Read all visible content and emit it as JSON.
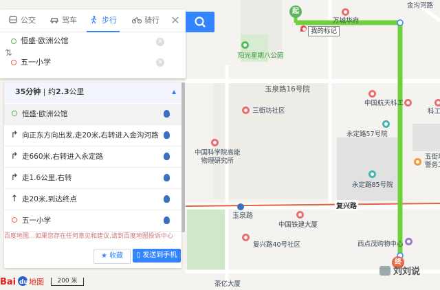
{
  "tabs": [
    {
      "label": "公交",
      "icon": "bus-icon"
    },
    {
      "label": "驾车",
      "icon": "car-icon"
    },
    {
      "label": "步行",
      "icon": "walk-icon"
    },
    {
      "label": "骑行",
      "icon": "bike-icon"
    }
  ],
  "route": {
    "start": "恒盛·欧洲公馆",
    "end": "五一小学"
  },
  "summary": {
    "time": "35分钟",
    "distance_prefix": "约",
    "distance": "2.3",
    "distance_unit": "公里"
  },
  "steps": [
    {
      "arrow": "dot-start",
      "text": "恒盛·欧洲公馆"
    },
    {
      "arrow": "turn-right",
      "text": "向正东方向出发,走20米,右转进入金沟河路"
    },
    {
      "arrow": "turn-right",
      "text": "走660米,右转进入永定路"
    },
    {
      "arrow": "turn-right",
      "text": "走1.6公里,右转"
    },
    {
      "arrow": "straight",
      "text": "走20米,到达终点"
    },
    {
      "arrow": "dot-end",
      "text": "五一小学"
    }
  ],
  "cut_notice": "百度地图…如果您存在任何意见和建议,请到百度地图投诉中心",
  "actions": {
    "favorite": "收藏",
    "send": "发送到手机"
  },
  "scale": "200 米",
  "logo": "Bai du 地图",
  "markers": {
    "start": "起",
    "end": "终",
    "my_mark": "我的标记"
  },
  "pois": {
    "wanshou": "万城华府",
    "jingou": "金沟河路",
    "yangguang": "阳光星期八公园",
    "yuquan16": "玉泉路16号院",
    "sanjiefang": "三街坊社区",
    "hangtian": "中国航天科工",
    "kegong": "科工",
    "yongding57": "永定路57号院",
    "kexueyuan_1": "中国科学院高能",
    "kexueyuan_2": "物理研究所",
    "wujiefang_1": "五街坊",
    "wujiefang_2": "警务工",
    "yongding85": "永定路85号院",
    "fuxinglu": "复兴路",
    "yuquanlu": "玉泉路",
    "tiejian": "中国铁建大厦",
    "fuxing40": "复兴路40号社区",
    "xidian": "西点茂购物中心",
    "bottom_cut": "茶亿大厦"
  },
  "watermark": "刘刘说",
  "colors": {
    "route": "#6fd13c",
    "accent": "#3385ff",
    "rail": "#e1623f",
    "green_area": "#cfe8c8"
  }
}
